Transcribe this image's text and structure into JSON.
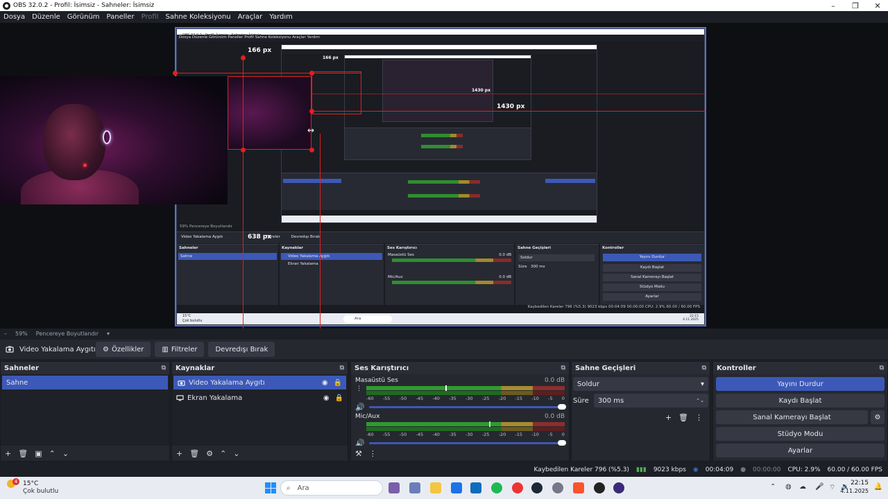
{
  "window": {
    "title": "OBS 32.0.2 - Profil: İsimsiz - Sahneler: İsimsiz",
    "minimize": "–",
    "maximize": "❐",
    "close": "✕"
  },
  "menu": {
    "items": [
      "Dosya",
      "Düzenle",
      "Görünüm",
      "Paneller",
      "Profil",
      "Sahne Koleksiyonu",
      "Araçlar",
      "Yardım"
    ]
  },
  "preview": {
    "label_166": "166 px",
    "label_1430": "1430 px",
    "label_638": "638 px",
    "inner_label_166": "166 px",
    "inner_label_1430": "1430 px",
    "inner_window_title": "OBS 32.0.2 - Profil: İsimsiz - Sahneler: İsimsiz",
    "inner_menu": "Dosya   Düzenle   Görünüm   Paneller   Profil   Sahne Koleksiyonu   Araçlar   Yardım",
    "inner_source": "Video Yakalama Aygıtı",
    "inner_filters": "Filtreler",
    "inner_disable": "Devredışı Bırak",
    "inner_zoom": "59%   Pencereye Boyutlandır",
    "inner_scenes": "Sahneler",
    "inner_sources": "Kaynaklar",
    "inner_mixer": "Ses Karıştırıcı",
    "inner_transitions": "Sahne Geçişleri",
    "inner_controls": "Kontroller",
    "inner_scene": "Sahne",
    "inner_src1": "Video Yakalama Aygıtı",
    "inner_src2": "Ekran Yakalama",
    "inner_desktop": "Masaüstü Ses",
    "inner_mic": "Mic/Aux",
    "inner_db": "0.0 dB",
    "inner_fade": "Soldur",
    "inner_duration_label": "Süre",
    "inner_duration": "300 ms",
    "inner_ctrl": [
      "Yayını Durdur",
      "Kaydı Başlat",
      "Sanal Kamerayı Başlat",
      "Stüdyo Modu",
      "Ayarlar"
    ],
    "inner_status": "Kaybedilen Kareler 796 (%5.3)   9023 kbps   00:04:09   00:00:00   CPU: 2.9%   60.00 / 60.00 FPS",
    "inner_search": "Ara",
    "inner_weather_temp": "15°C",
    "inner_weather_desc": "Çok bulutlu",
    "inner_clock": "22:15\n4.11.2025"
  },
  "zoom": {
    "minus": "–",
    "percent": "59%",
    "fit": "Pencereye Boyutlandır",
    "dropdown": "▾"
  },
  "source_toolbar": {
    "source_name": "Video Yakalama Aygıtı",
    "properties": "Özellikler",
    "filters": "Filtreler",
    "disable": "Devredışı Bırak"
  },
  "scenes": {
    "title": "Sahneler",
    "items": [
      "Sahne"
    ]
  },
  "sources": {
    "title": "Kaynaklar",
    "items": [
      {
        "label": "Video Yakalama Aygıtı",
        "icon": "camera-icon"
      },
      {
        "label": "Ekran Yakalama",
        "icon": "monitor-icon"
      }
    ]
  },
  "mixer": {
    "title": "Ses Karıştırıcı",
    "channels": [
      {
        "name": "Masaüstü Ses",
        "db": "0.0 dB",
        "level": 0.4
      },
      {
        "name": "Mic/Aux",
        "db": "0.0 dB",
        "level": 0.62
      }
    ],
    "ticks": [
      "-60",
      "-55",
      "-50",
      "-45",
      "-40",
      "-35",
      "-30",
      "-25",
      "-20",
      "-15",
      "-10",
      "-5",
      "0"
    ]
  },
  "transitions": {
    "title": "Sahne Geçişleri",
    "selected": "Soldur",
    "duration_label": "Süre",
    "duration_value": "300 ms"
  },
  "controls": {
    "title": "Kontroller",
    "stop_stream": "Yayını Durdur",
    "start_record": "Kaydı Başlat",
    "start_virtualcam": "Sanal Kamerayı Başlat",
    "studio_mode": "Stüdyo Modu",
    "settings": "Ayarlar"
  },
  "status": {
    "dropped": "Kaybedilen Kareler 796 (%5.3)",
    "bitrate": "9023 kbps",
    "stream_time": "00:04:09",
    "record_time": "00:00:00",
    "cpu": "CPU: 2.9%",
    "fps": "60.00 / 60.00 FPS"
  },
  "taskbar": {
    "weather_temp": "15°C",
    "weather_desc": "Çok bulutlu",
    "weather_badge": "4",
    "search_placeholder": "Ara",
    "time": "22:15",
    "date": "4.11.2025"
  },
  "colors": {
    "accent": "#3c59b8",
    "guide": "#e02020",
    "canvas_border": "#4d76d9"
  }
}
